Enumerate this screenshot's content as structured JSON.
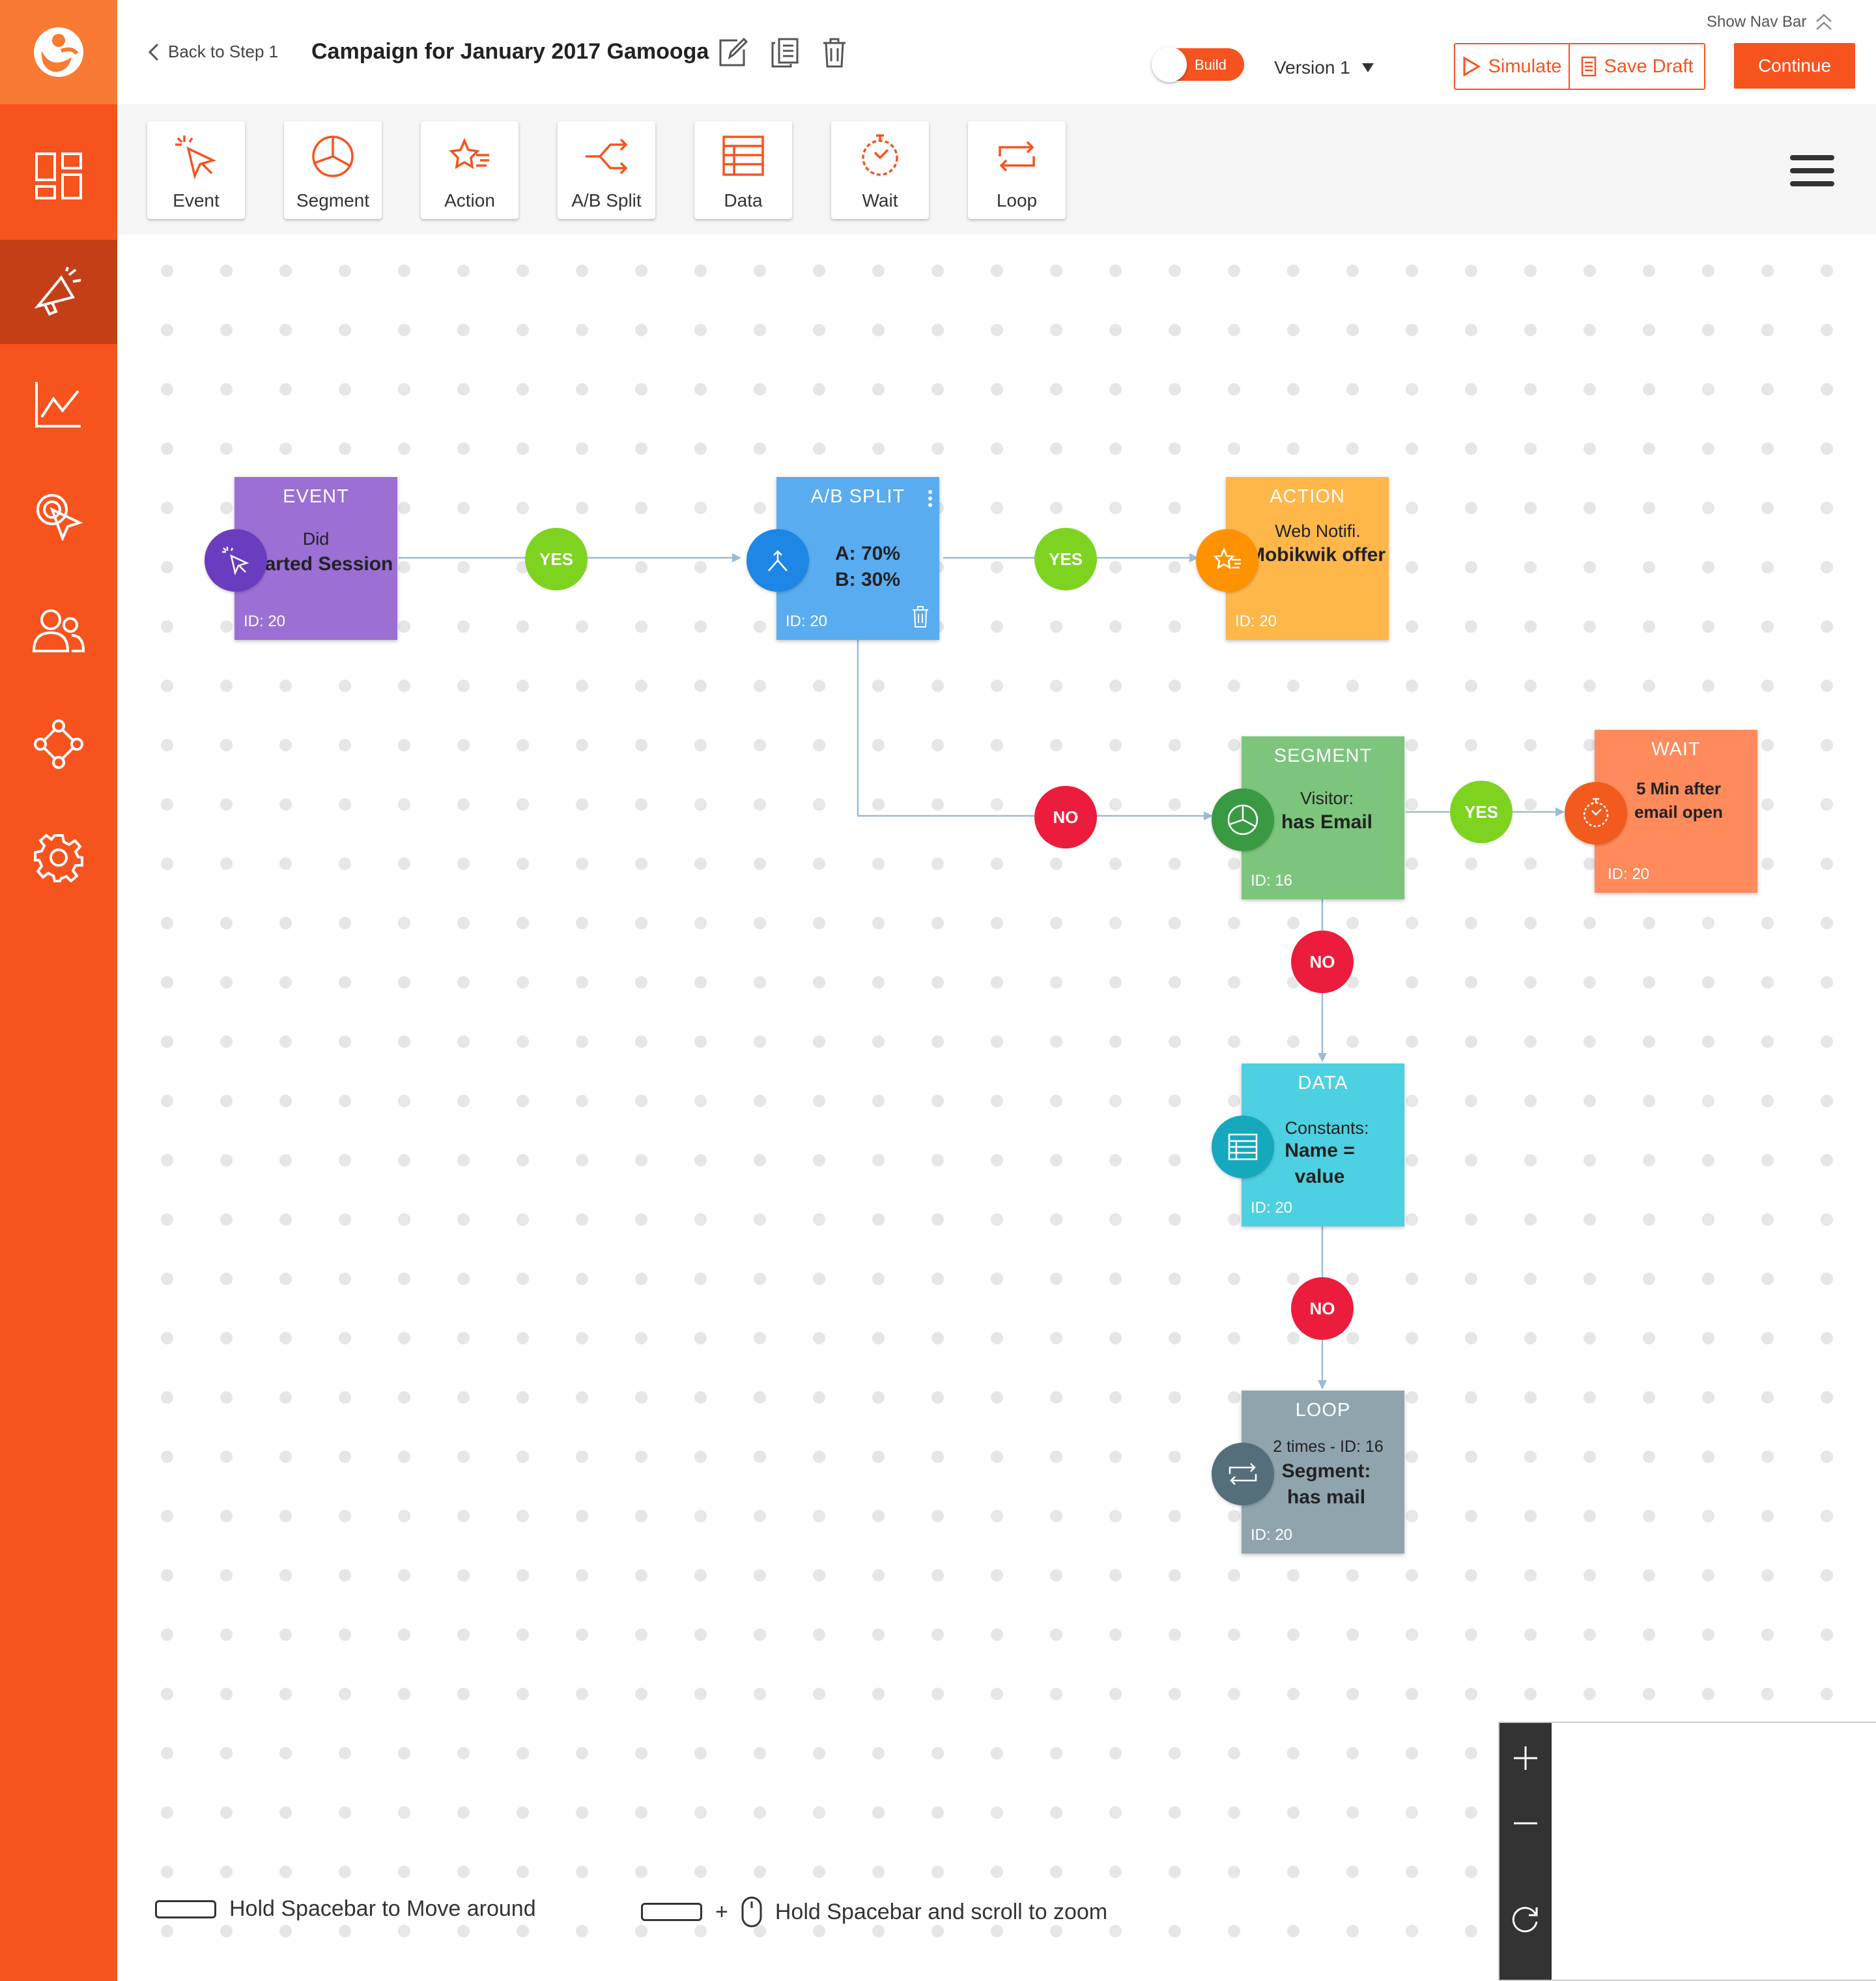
{
  "header": {
    "back_label": "Back to Step 1",
    "campaign_title": "Campaign for January 2017 Gamooga",
    "toggle_label": "Build",
    "version_label": "Version 1",
    "show_nav_label": "Show Nav Bar",
    "simulate_label": "Simulate",
    "save_draft_label": "Save Draft",
    "continue_label": "Continue"
  },
  "sidebar": {
    "items": [
      "dashboard-icon",
      "campaign-megaphone-icon",
      "analytics-chart-icon",
      "click-cursor-icon",
      "users-icon",
      "workflow-icon",
      "settings-gear-icon"
    ],
    "active_index": 1
  },
  "toolbar": {
    "tools": [
      {
        "label": "Event",
        "icon": "cursor-click-icon"
      },
      {
        "label": "Segment",
        "icon": "pie-chart-icon"
      },
      {
        "label": "Action",
        "icon": "star-lines-icon"
      },
      {
        "label": "A/B Split",
        "icon": "split-arrows-icon"
      },
      {
        "label": "Data",
        "icon": "table-icon"
      },
      {
        "label": "Wait",
        "icon": "stopwatch-icon"
      },
      {
        "label": "Loop",
        "icon": "loop-arrows-icon"
      }
    ]
  },
  "nodes": {
    "event": {
      "title": "EVENT",
      "sub": "Did",
      "main": "Started Session",
      "id": "ID: 20",
      "color": "#9b6fd4",
      "circle": "#6a3cc0"
    },
    "ab_split": {
      "title": "A/B SPLIT",
      "main_a": "A: 70%",
      "main_b": "B: 30%",
      "id": "ID: 20",
      "color": "#5aacf0",
      "circle": "#1e86e4"
    },
    "action": {
      "title": "ACTION",
      "sub": "Web Notifi.",
      "main": "Mobikwik offer",
      "id": "ID: 20",
      "color": "#ffb74a",
      "circle": "#ff9200"
    },
    "segment": {
      "title": "SEGMENT",
      "sub": "Visitor:",
      "main": "has Email",
      "id": "ID: 16",
      "color": "#7dc57d",
      "circle": "#3a9a44"
    },
    "wait": {
      "title": "WAIT",
      "main": "5 Min after email open",
      "id": "ID: 20",
      "color": "#ff8a5c",
      "circle": "#f35a1e"
    },
    "data": {
      "title": "DATA",
      "sub": "Constants:",
      "main": "Name = value",
      "id": "ID: 20",
      "color": "#4dd0e1",
      "circle": "#16a8bd"
    },
    "loop": {
      "title": "LOOP",
      "sub": "2 times - ID: 16",
      "main": "Segment: has mail",
      "id": "ID: 20",
      "color": "#90a4ae",
      "circle": "#546e7a"
    }
  },
  "badges": {
    "yes": "YES",
    "no": "NO"
  },
  "hints": {
    "move": "Hold Spacebar to Move around",
    "plus": "+",
    "zoom": "Hold Spacebar and scroll to zoom"
  }
}
